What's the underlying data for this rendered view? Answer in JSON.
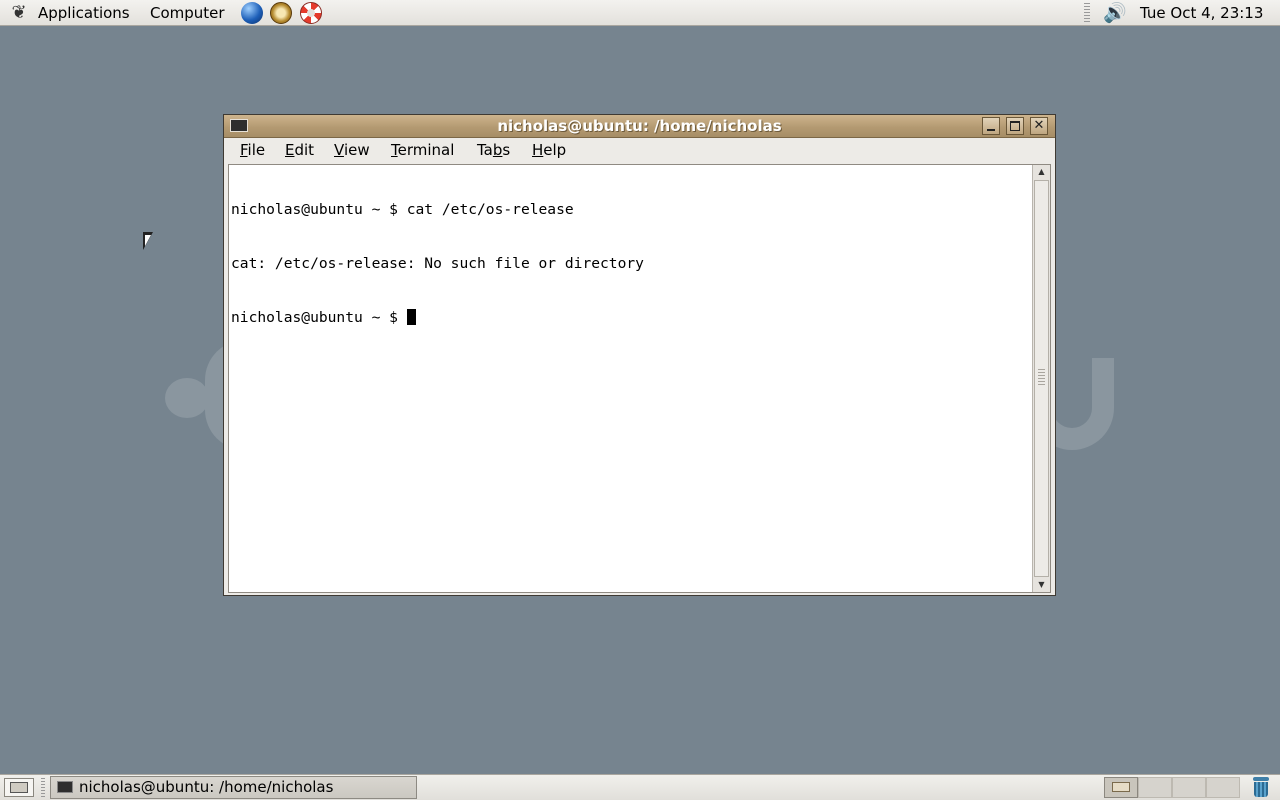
{
  "top_panel": {
    "applications_label": "Applications",
    "computer_label": "Computer",
    "launchers": [
      "web-browser-icon",
      "compass-icon",
      "help-icon"
    ],
    "clock": "Tue Oct  4, 23:13"
  },
  "window": {
    "title": "nicholas@ubuntu: /home/nicholas",
    "menu": {
      "file": "F",
      "file_rest": "ile",
      "edit": "E",
      "edit_rest": "dit",
      "view": "V",
      "view_rest": "iew",
      "terminal": "T",
      "terminal_rest": "erminal",
      "tabs_pre": "Ta",
      "tabs": "b",
      "tabs_rest": "s",
      "help": "H",
      "help_rest": "elp"
    },
    "terminal_lines": [
      "nicholas@ubuntu ~ $ cat /etc/os-release",
      "cat: /etc/os-release: No such file or directory",
      "nicholas@ubuntu ~ $ "
    ]
  },
  "bottom_panel": {
    "task_label": "nicholas@ubuntu: /home/nicholas",
    "workspaces": 4,
    "active_workspace": 1
  },
  "colors": {
    "desktop": "#76848f",
    "titlebar": "#b49a72",
    "panel": "#e3e1dc"
  }
}
